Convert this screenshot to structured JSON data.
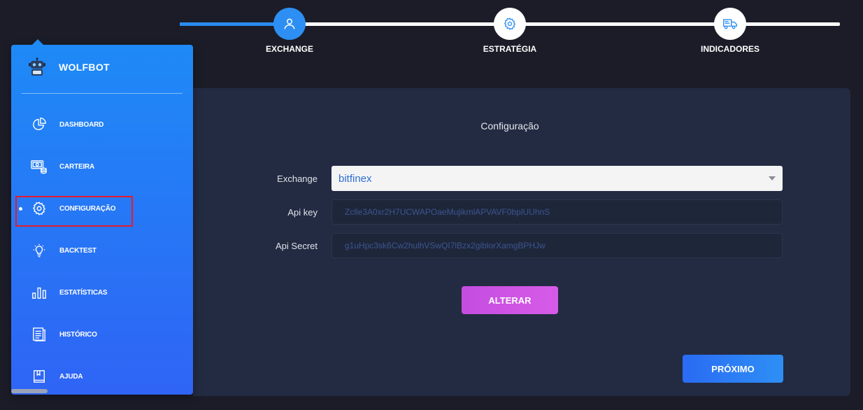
{
  "stepper": {
    "steps": [
      {
        "label": "EXCHANGE",
        "icon": "user-icon",
        "active": true
      },
      {
        "label": "ESTRATÉGIA",
        "icon": "gear-icon",
        "active": false
      },
      {
        "label": "INDICADORES",
        "icon": "shipping-truck-icon",
        "active": false
      }
    ]
  },
  "sidebar": {
    "brand": "WOLFBOT",
    "items": [
      {
        "label": "DASHBOARD",
        "icon": "pie-chart-icon"
      },
      {
        "label": "CARTEIRA",
        "icon": "wallet-money-icon"
      },
      {
        "label": "CONFIGURAÇÃO",
        "icon": "gear-icon",
        "active": true
      },
      {
        "label": "BACKTEST",
        "icon": "lightbulb-icon"
      },
      {
        "label": "ESTATÍSTICAS",
        "icon": "bar-chart-icon"
      },
      {
        "label": "HISTÓRICO",
        "icon": "document-icon"
      },
      {
        "label": "AJUDA",
        "icon": "book-icon"
      }
    ]
  },
  "main": {
    "title": "Configuração",
    "exchange_label": "Exchange",
    "exchange_value": "bitfinex",
    "api_key_label": "Api key",
    "api_key_value": "Zclle3A0xr2H7UCWAPOaeMujikmlAPVAVF0bplUUhnS",
    "api_secret_label": "Api Secret",
    "api_secret_value": "g1uHpc3sk6Cw2hulhVSwQI7lBzx2giblorXamgBPHJw",
    "alterar_label": "ALTERAR",
    "proximo_label": "PRÓXIMO"
  },
  "colors": {
    "background": "#1b1c27",
    "sidebar_top": "#1e8af6",
    "sidebar_bottom": "#2f64f5",
    "card": "#232b42",
    "alterar": "#cc52e4",
    "proximo": "#2a7ef4",
    "highlight": "#e31d2b"
  }
}
